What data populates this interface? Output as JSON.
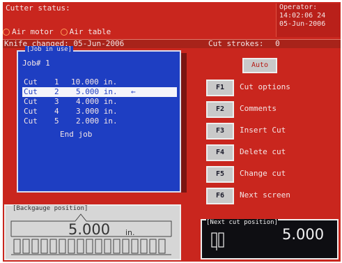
{
  "header": {
    "cutter_status_label": "Cutter status:",
    "air_motor_label": "Air motor",
    "air_table_label": "Air table",
    "operator_label": "Operator:",
    "time": "14:02:06 24",
    "date": "05-Jun-2006"
  },
  "info_bar": {
    "knife_changed_label": "Knife changed: 05-Jun-2006",
    "cut_strokes_label": "Cut strokes:",
    "cut_strokes_value": "0"
  },
  "job": {
    "legend": "[Job in use]",
    "number_label": "Job# 1",
    "rows": [
      {
        "type": "Cut",
        "index": "1",
        "value": "10.000 in."
      },
      {
        "type": "Cut",
        "index": "2",
        "value": "5.000 in.",
        "marker": "←"
      },
      {
        "type": "Cut",
        "index": "3",
        "value": "4.000 in."
      },
      {
        "type": "Cut",
        "index": "4",
        "value": "3.000 in."
      },
      {
        "type": "Cut",
        "index": "5",
        "value": "2.000 in."
      }
    ],
    "end_label": "End job",
    "selected_row": 1
  },
  "controls": {
    "auto_label": "Auto",
    "function_keys": [
      {
        "key": "F1",
        "label": "Cut options"
      },
      {
        "key": "F2",
        "label": "Comments"
      },
      {
        "key": "F3",
        "label": "Insert Cut"
      },
      {
        "key": "F4",
        "label": "Delete cut"
      },
      {
        "key": "F5",
        "label": "Change cut"
      },
      {
        "key": "F6",
        "label": "Next screen"
      }
    ]
  },
  "backgauge": {
    "legend": "[Backgauge position]",
    "value": "5.000",
    "unit": "in."
  },
  "next_cut": {
    "legend": "[Next cut position]",
    "value": "5.000"
  },
  "colors": {
    "screen_background": "#c9261e",
    "job_panel": "#1e3ec2",
    "selected_row": "#f4f4fa",
    "button_face": "#c9c9c9"
  }
}
